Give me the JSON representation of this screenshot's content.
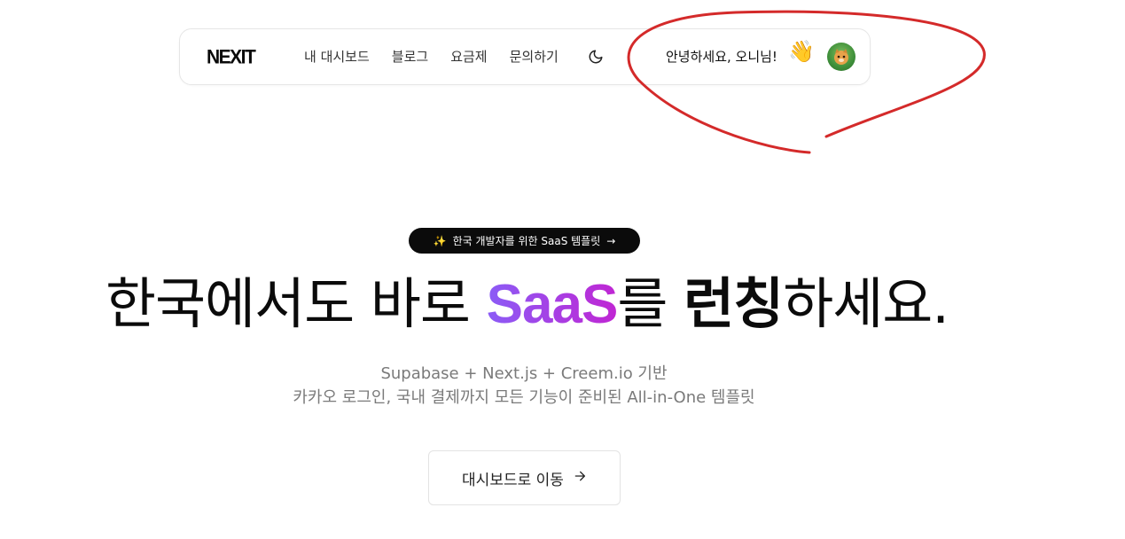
{
  "nav": {
    "logo": "NEXIT",
    "links": [
      "내 대시보드",
      "블로그",
      "요금제",
      "문의하기"
    ],
    "theme_icon": "moon-icon",
    "greeting": "안녕하세요, 오니님!",
    "wave_icon": "waving-hand-icon",
    "avatar_icon": "avatar-image"
  },
  "hero": {
    "badge_text": "한국 개발자를 위한 SaaS 템플릿",
    "badge_icon": "sparkles-icon",
    "headline_pre": "한국에서도 바로 ",
    "headline_accent": "SaaS",
    "headline_mid": "를 ",
    "headline_bold": "런칭",
    "headline_post": "하세요.",
    "subtitle_line1": "Supabase + Next.js + Creem.io 기반",
    "subtitle_line2": "카카오 로그인, 국내 결제까지 모든 기능이 준비된 All-in-One 템플릿",
    "cta_label": "대시보드로 이동"
  },
  "colors": {
    "accent_start": "#8b5cf6",
    "accent_end": "#c026d3",
    "annotation": "#d42a2a",
    "badge_bg": "#0b0b0b"
  }
}
